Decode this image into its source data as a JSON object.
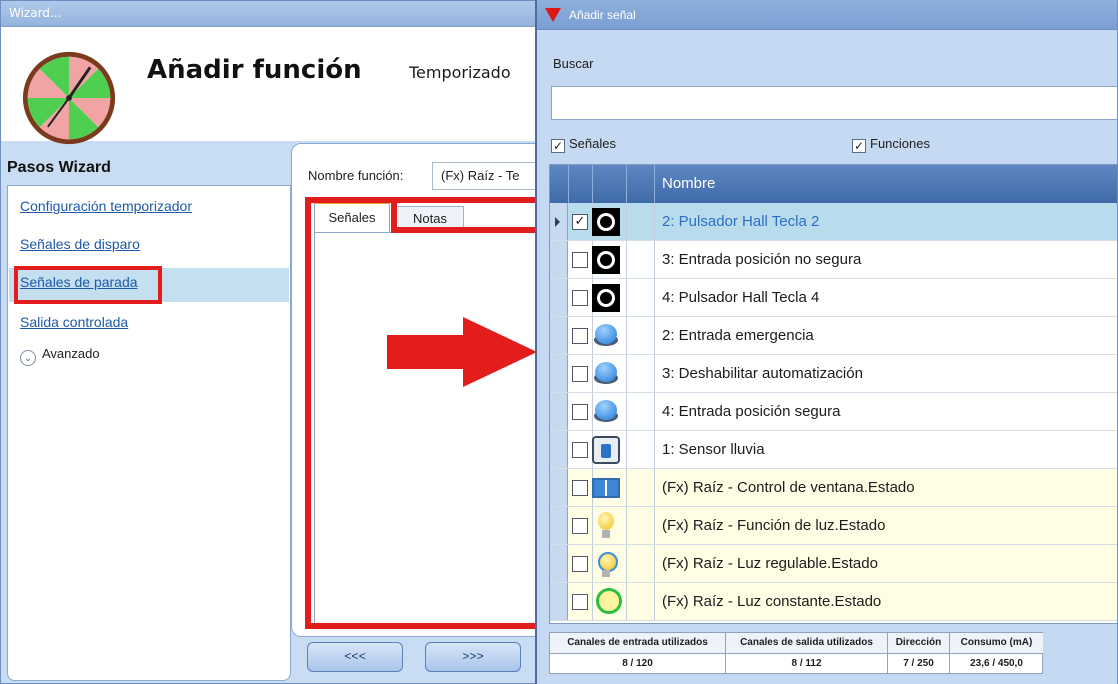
{
  "wizard": {
    "window_title": "Wizard...",
    "title": "Añadir función",
    "subtitle": "Temporizado",
    "steps_title": "Pasos Wizard",
    "steps": [
      {
        "label": "Configuración temporizador"
      },
      {
        "label": "Señales de disparo"
      },
      {
        "label": "Señales de parada"
      },
      {
        "label": "Salida controlada"
      }
    ],
    "advanced_label": "Avanzado",
    "function_name_label": "Nombre función:",
    "function_name_value": "(Fx) Raíz - Te",
    "tabs": [
      {
        "label": "Señales"
      },
      {
        "label": "Notas"
      }
    ],
    "back_button": "<<<",
    "next_button": ">>>"
  },
  "dialog": {
    "title": "Añadir señal",
    "search_label": "Buscar",
    "search_value": "",
    "filter_signals_label": "Señales",
    "filter_signals_checked": true,
    "filter_functions_label": "Funciones",
    "filter_functions_checked": true,
    "column_name": "Nombre",
    "rows": [
      {
        "name": "2: Pulsador Hall Tecla 2",
        "icon": "hall-button-icon",
        "checked": true,
        "selected": true,
        "fx": false
      },
      {
        "name": "3: Entrada posición no segura",
        "icon": "hall-button-icon",
        "checked": false,
        "selected": false,
        "fx": false
      },
      {
        "name": "4: Pulsador Hall Tecla 4",
        "icon": "hall-button-icon",
        "checked": false,
        "selected": false,
        "fx": false
      },
      {
        "name": "2: Entrada emergencia",
        "icon": "push-button-icon",
        "checked": false,
        "selected": false,
        "fx": false
      },
      {
        "name": "3: Deshabilitar automatización",
        "icon": "push-button-icon",
        "checked": false,
        "selected": false,
        "fx": false
      },
      {
        "name": "4: Entrada posición segura",
        "icon": "push-button-icon",
        "checked": false,
        "selected": false,
        "fx": false
      },
      {
        "name": "1: Sensor lluvia",
        "icon": "rain-sensor-icon",
        "checked": false,
        "selected": false,
        "fx": false
      },
      {
        "name": "(Fx) Raíz - Control de ventana.Estado",
        "icon": "window-icon",
        "checked": false,
        "selected": false,
        "fx": true
      },
      {
        "name": "(Fx) Raíz - Función de luz.Estado",
        "icon": "bulb-icon",
        "checked": false,
        "selected": false,
        "fx": true
      },
      {
        "name": "(Fx) Raíz - Luz regulable.Estado",
        "icon": "dimmable-bulb-icon",
        "checked": false,
        "selected": false,
        "fx": true
      },
      {
        "name": "(Fx) Raíz - Luz constante.Estado",
        "icon": "constant-light-icon",
        "checked": false,
        "selected": false,
        "fx": true
      }
    ],
    "stats": {
      "input_channels_label": "Canales de entrada utilizados",
      "input_channels_value": "8 / 120",
      "output_channels_label": "Canales de salida utilizados",
      "output_channels_value": "8 / 112",
      "address_label": "Dirección",
      "address_value": "7 / 250",
      "consumption_label": "Consumo (mA)",
      "consumption_value": "23,6 / 450,0"
    }
  },
  "colors": {
    "highlight_red": "#e31c1c",
    "selected_row": "#b8dcec",
    "fx_row": "#fffde4",
    "header_blue": "#3e6aa9",
    "link_blue": "#1d5aa8"
  }
}
